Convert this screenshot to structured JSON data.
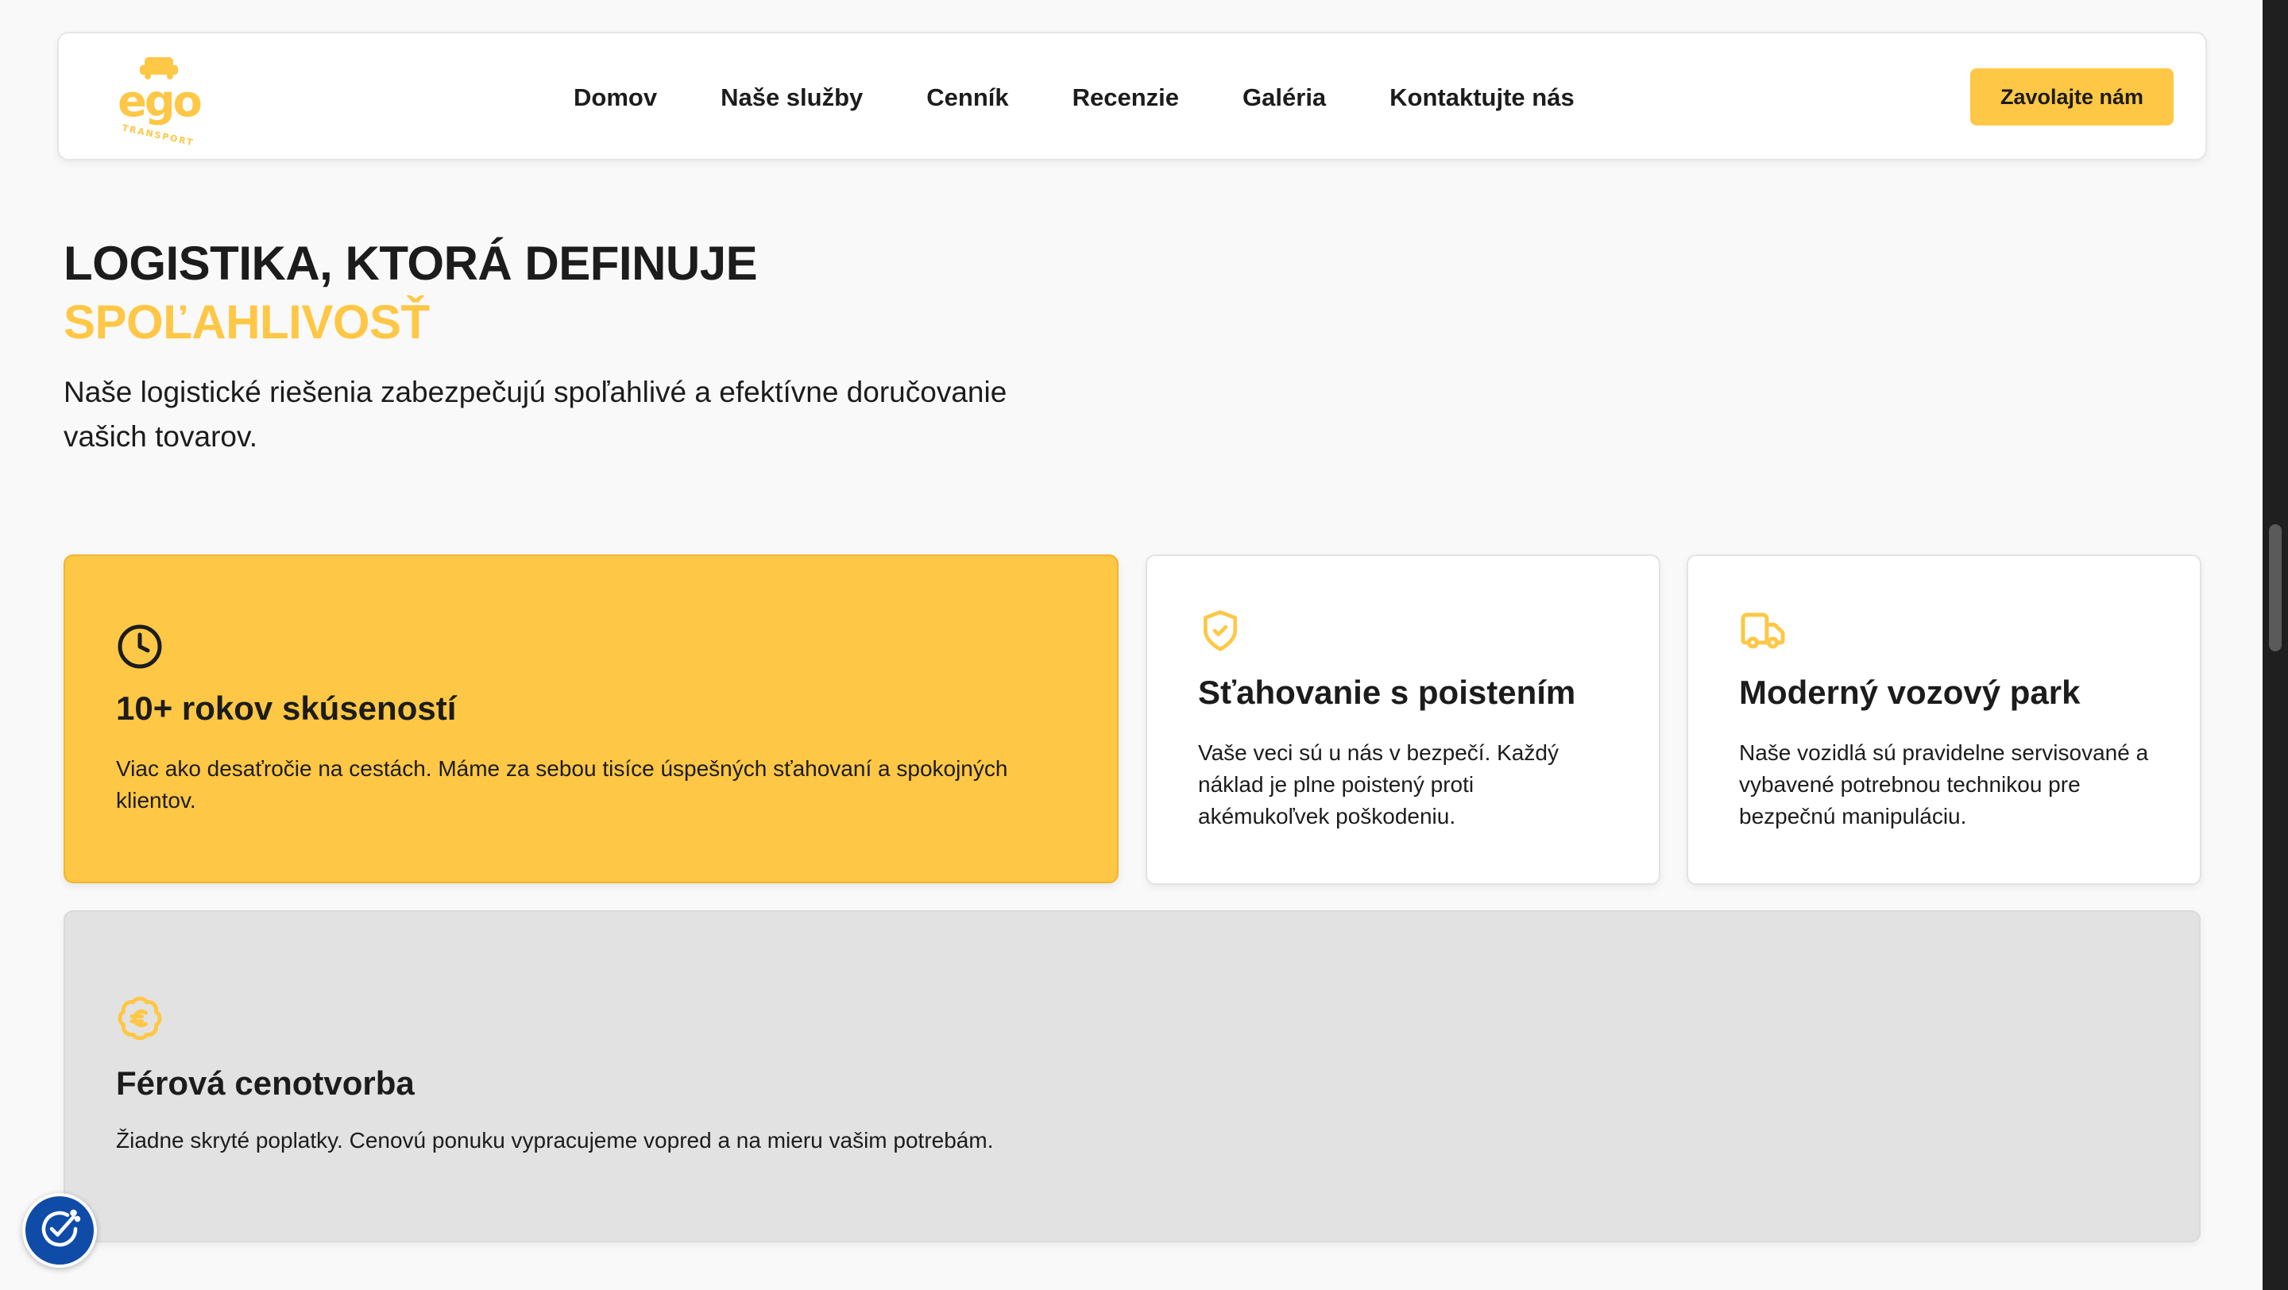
{
  "header": {
    "logo_text": "ego",
    "logo_subtext": "TRANSPORT",
    "nav": [
      {
        "label": "Domov"
      },
      {
        "label": "Naše služby"
      },
      {
        "label": "Cenník"
      },
      {
        "label": "Recenzie"
      },
      {
        "label": "Galéria"
      },
      {
        "label": "Kontaktujte nás"
      }
    ],
    "cta_label": "Zavolajte nám"
  },
  "hero": {
    "title": "LOGISTIKA, KTORÁ DEFINUJE",
    "title_accent": "SPOĽAHLIVOSŤ",
    "description": "Naše logistické riešenia zabezpečujú spoľahlivé a efektívne doručovanie vašich tovarov."
  },
  "features": [
    {
      "icon": "clock-icon",
      "title": "10+ rokov skúseností",
      "text": "Viac ako desaťročie na cestách. Máme za sebou tisíce úspešných sťahovaní a spokojných klientov."
    },
    {
      "icon": "shield-check-icon",
      "title": "Sťahovanie s poistením",
      "text": "Vaše veci sú u nás v bezpečí. Každý náklad je plne poistený proti akémukoľvek poškodeniu."
    },
    {
      "icon": "truck-icon",
      "title": "Moderný vozový park",
      "text": "Naše vozidlá sú pravidelne servisované a vybavené potrebnou technikou pre bezpečnú manipuláciu."
    },
    {
      "icon": "euro-badge-icon",
      "title": "Férová cenotvorba",
      "text": "Žiadne skryté poplatky. Cenovú ponuku vypracujeme vopred a na mieru vašim potrebám."
    }
  ],
  "colors": {
    "accent": "#fec745",
    "text": "#1c1c1c",
    "background": "#f9f9f9",
    "gray_card": "#e2e2e2",
    "a11y_button": "#0f4ca8"
  }
}
